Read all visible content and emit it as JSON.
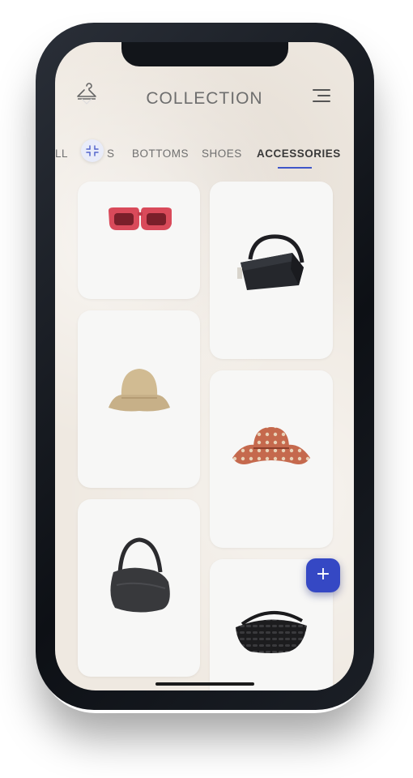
{
  "header": {
    "title": "COLLECTION",
    "left_icon": "hanger-icon",
    "right_icon": "menu-icon"
  },
  "tabs": [
    {
      "label": "LL",
      "active": false
    },
    {
      "label": "S",
      "active": false
    },
    {
      "label": "BOTTOMS",
      "active": false
    },
    {
      "label": "SHOES",
      "active": false
    },
    {
      "label": "ACCESSORIES",
      "active": true
    }
  ],
  "filter_icon": "filter-icon",
  "items": [
    {
      "name": "red sunglasses",
      "icon": "sunglasses-icon"
    },
    {
      "name": "black leather handbag",
      "icon": "handbag-icon"
    },
    {
      "name": "beige bucket hat",
      "icon": "bucket-hat-icon"
    },
    {
      "name": "patterned sun hat",
      "icon": "sun-hat-icon"
    },
    {
      "name": "black hobo bag",
      "icon": "hobo-bag-icon"
    },
    {
      "name": "black woven bag",
      "icon": "woven-bag-icon"
    }
  ],
  "fab": {
    "label": "+"
  },
  "colors": {
    "accent": "#3548c4",
    "background": "#efe9e1",
    "card": "#f7f7f6"
  }
}
